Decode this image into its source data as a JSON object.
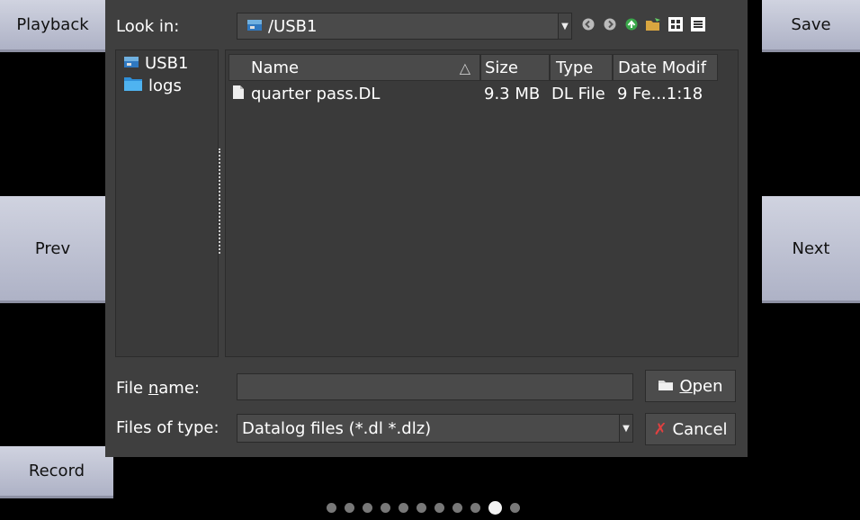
{
  "side_buttons": {
    "playback": "Playback",
    "save": "Save",
    "prev": "Prev",
    "next": "Next",
    "record": "Record"
  },
  "dialog": {
    "look_in_label": "Look in:",
    "look_in_value": "/USB1",
    "toolbar_icons": [
      "back-icon",
      "forward-icon",
      "up-icon",
      "new-folder-icon",
      "icon-view-icon",
      "list-view-icon"
    ],
    "tree": [
      {
        "label": "USB1",
        "icon": "drive-icon"
      },
      {
        "label": "logs",
        "icon": "folder-icon"
      }
    ],
    "columns": [
      "Name",
      "Size",
      "Type",
      "Date Modif"
    ],
    "files": [
      {
        "name": "quarter pass.DL",
        "size": "9.3 MB",
        "type": "DL File",
        "date": "9 Fe...1:18"
      }
    ],
    "file_name_label_prefix": "File ",
    "file_name_label_mnemonic": "n",
    "file_name_label_suffix": "ame:",
    "file_name_value": "",
    "files_of_type_label": "Files of type:",
    "files_of_type_value": "Datalog files (*.dl *.dlz)",
    "open_mnemonic": "O",
    "open_rest": "pen",
    "cancel_label": "Cancel"
  },
  "pager": {
    "count": 11,
    "active_index": 9
  },
  "colors": {
    "side_button": "#c4c7d6",
    "dialog_bg": "#3f3f3f",
    "accent_folder": "#3aa8e8"
  }
}
